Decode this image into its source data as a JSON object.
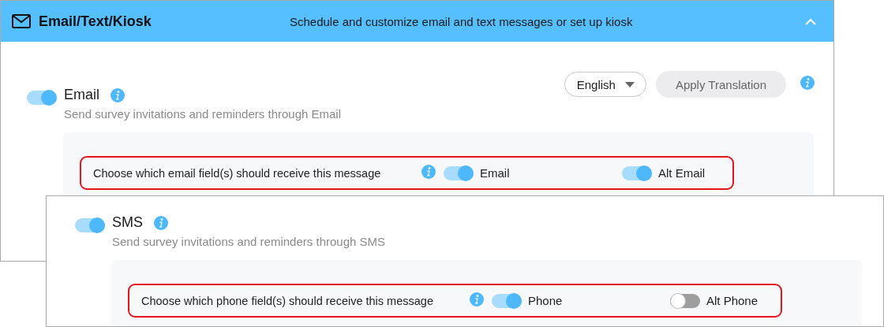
{
  "header": {
    "title": "Email/Text/Kiosk",
    "subtitle": "Schedule and customize email and text messages or set up kiosk",
    "expanded": true
  },
  "language": {
    "value": "English"
  },
  "apply_button": {
    "label": "Apply Translation",
    "disabled": true
  },
  "channels": [
    {
      "name": "Email",
      "on": true,
      "description": "Send survey invitations and reminders through Email",
      "field_prompt": "Choose which email field(s) should receive this message",
      "fields": [
        {
          "label": "Email",
          "on": true
        },
        {
          "label": "Alt Email",
          "on": true
        }
      ]
    },
    {
      "name": "SMS",
      "on": true,
      "description": "Send survey invitations and reminders through SMS",
      "field_prompt": "Choose which phone field(s) should receive this message",
      "fields": [
        {
          "label": "Phone",
          "on": true
        },
        {
          "label": "Alt Phone",
          "on": false
        }
      ]
    }
  ]
}
